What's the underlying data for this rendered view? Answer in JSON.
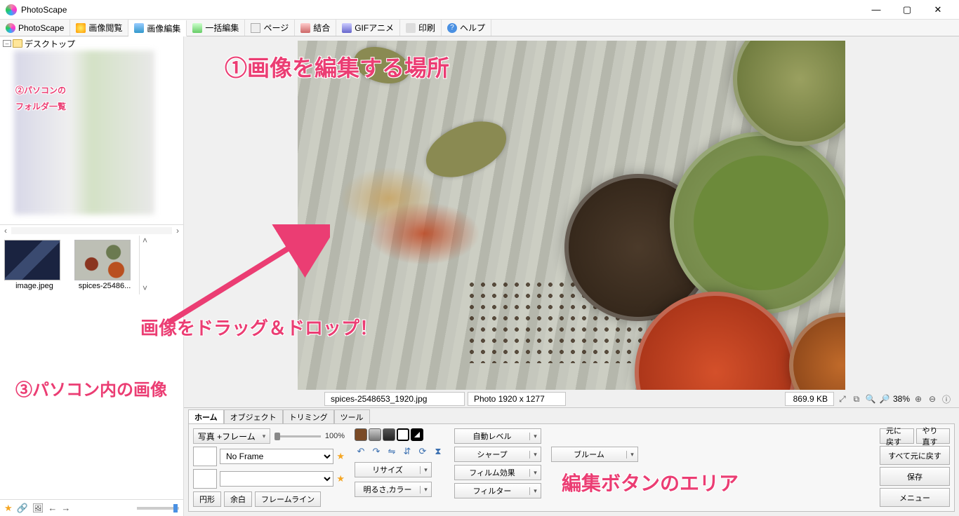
{
  "window": {
    "title": "PhotoScape"
  },
  "maintabs": [
    {
      "label": "PhotoScape"
    },
    {
      "label": "画像閲覧"
    },
    {
      "label": "画像編集",
      "active": true
    },
    {
      "label": "一括編集"
    },
    {
      "label": "ページ"
    },
    {
      "label": "結合"
    },
    {
      "label": "GIFアニメ"
    },
    {
      "label": "印刷"
    },
    {
      "label": "ヘルプ"
    }
  ],
  "tree": {
    "root_label": "デスクトップ"
  },
  "thumbnails": [
    {
      "caption": "image.jpeg"
    },
    {
      "caption": "spices-25486..."
    }
  ],
  "status": {
    "filename": "spices-2548653_1920.jpg",
    "dimensions": "Photo 1920 x 1277",
    "filesize": "869.9 KB",
    "zoom": "38%"
  },
  "subtabs": [
    {
      "label": "ホーム",
      "active": true
    },
    {
      "label": "オブジェクト"
    },
    {
      "label": "トリミング"
    },
    {
      "label": "ツール"
    }
  ],
  "panel": {
    "photo_frame_btn": "写真 +フレーム",
    "slider_pct": "100%",
    "frame_select": "No Frame",
    "round": "円形",
    "margin": "余白",
    "frameline": "フレームライン",
    "resize": "リサイズ",
    "brightcolor": "明るさ,カラー",
    "autolevel": "自動レベル",
    "sharp": "シャープ",
    "filmfx": "フィルム効果",
    "filter": "フィルター",
    "bloom": "ブルーム",
    "undo": "元に戻す",
    "redo": "やり直す",
    "undoall": "すべて元に戻す",
    "save": "保存",
    "menu": "メニュー"
  },
  "annotations": {
    "a1": "①画像を編集する場所",
    "a2a": "②パソコンの",
    "a2b": "フォルダ一覧",
    "a3": "画像をドラッグ＆ドロップ！",
    "a4": "③パソコン内の画像",
    "a5": "編集ボタンのエリア"
  }
}
